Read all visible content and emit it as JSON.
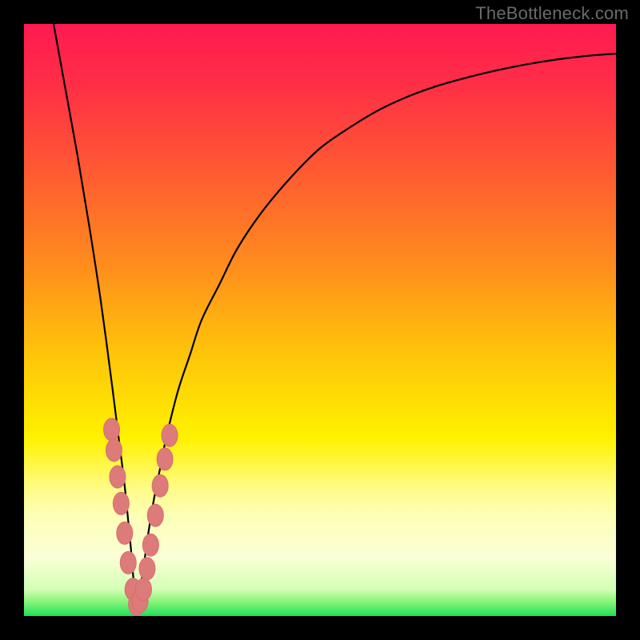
{
  "watermark": "TheBottleneck.com",
  "colors": {
    "frame": "#000000",
    "curve": "#000000",
    "markers_fill": "#dd7a7a",
    "markers_stroke": "#d86e6e",
    "watermark_text": "#6a6a6a",
    "gradient_stops": [
      {
        "offset": 0.0,
        "color": "#ff1a52"
      },
      {
        "offset": 0.1,
        "color": "#ff2e46"
      },
      {
        "offset": 0.25,
        "color": "#ff5a32"
      },
      {
        "offset": 0.4,
        "color": "#ff8a1e"
      },
      {
        "offset": 0.55,
        "color": "#ffc20a"
      },
      {
        "offset": 0.7,
        "color": "#fff200"
      },
      {
        "offset": 0.78,
        "color": "#fffb80"
      },
      {
        "offset": 0.83,
        "color": "#fcffb6"
      },
      {
        "offset": 0.9,
        "color": "#fbffd6"
      },
      {
        "offset": 0.955,
        "color": "#d4ffb4"
      },
      {
        "offset": 0.975,
        "color": "#8cf57a"
      },
      {
        "offset": 1.0,
        "color": "#1fe05a"
      }
    ]
  },
  "chart_data": {
    "type": "line",
    "title": "",
    "xlabel": "",
    "ylabel": "",
    "xlim": [
      0,
      100
    ],
    "ylim": [
      0,
      100
    ],
    "x_min_at": 19,
    "series": [
      {
        "name": "bottleneck-curve",
        "x": [
          5,
          7,
          9,
          11,
          13,
          15,
          16,
          17,
          18,
          19,
          20,
          21,
          22,
          23,
          24,
          26,
          28,
          30,
          33,
          36,
          40,
          45,
          50,
          55,
          60,
          65,
          70,
          75,
          80,
          85,
          90,
          95,
          100
        ],
        "values": [
          100,
          89,
          78,
          66,
          53,
          38,
          30,
          22,
          12,
          2,
          7,
          14,
          20,
          25,
          30,
          38,
          44,
          50,
          56,
          62,
          68,
          74,
          79,
          82.5,
          85.5,
          87.8,
          89.6,
          91.0,
          92.2,
          93.2,
          94.0,
          94.6,
          95.0
        ]
      }
    ],
    "markers": [
      {
        "x": 14.8,
        "y": 31.5
      },
      {
        "x": 15.2,
        "y": 28.0
      },
      {
        "x": 15.8,
        "y": 23.5
      },
      {
        "x": 16.4,
        "y": 19.0
      },
      {
        "x": 17.0,
        "y": 14.0
      },
      {
        "x": 17.6,
        "y": 9.0
      },
      {
        "x": 18.4,
        "y": 4.5
      },
      {
        "x": 19.0,
        "y": 2.0
      },
      {
        "x": 19.6,
        "y": 2.5
      },
      {
        "x": 20.2,
        "y": 4.5
      },
      {
        "x": 20.8,
        "y": 8.0
      },
      {
        "x": 21.4,
        "y": 12.0
      },
      {
        "x": 22.2,
        "y": 17.0
      },
      {
        "x": 23.0,
        "y": 22.0
      },
      {
        "x": 23.8,
        "y": 26.5
      },
      {
        "x": 24.6,
        "y": 30.5
      }
    ]
  }
}
